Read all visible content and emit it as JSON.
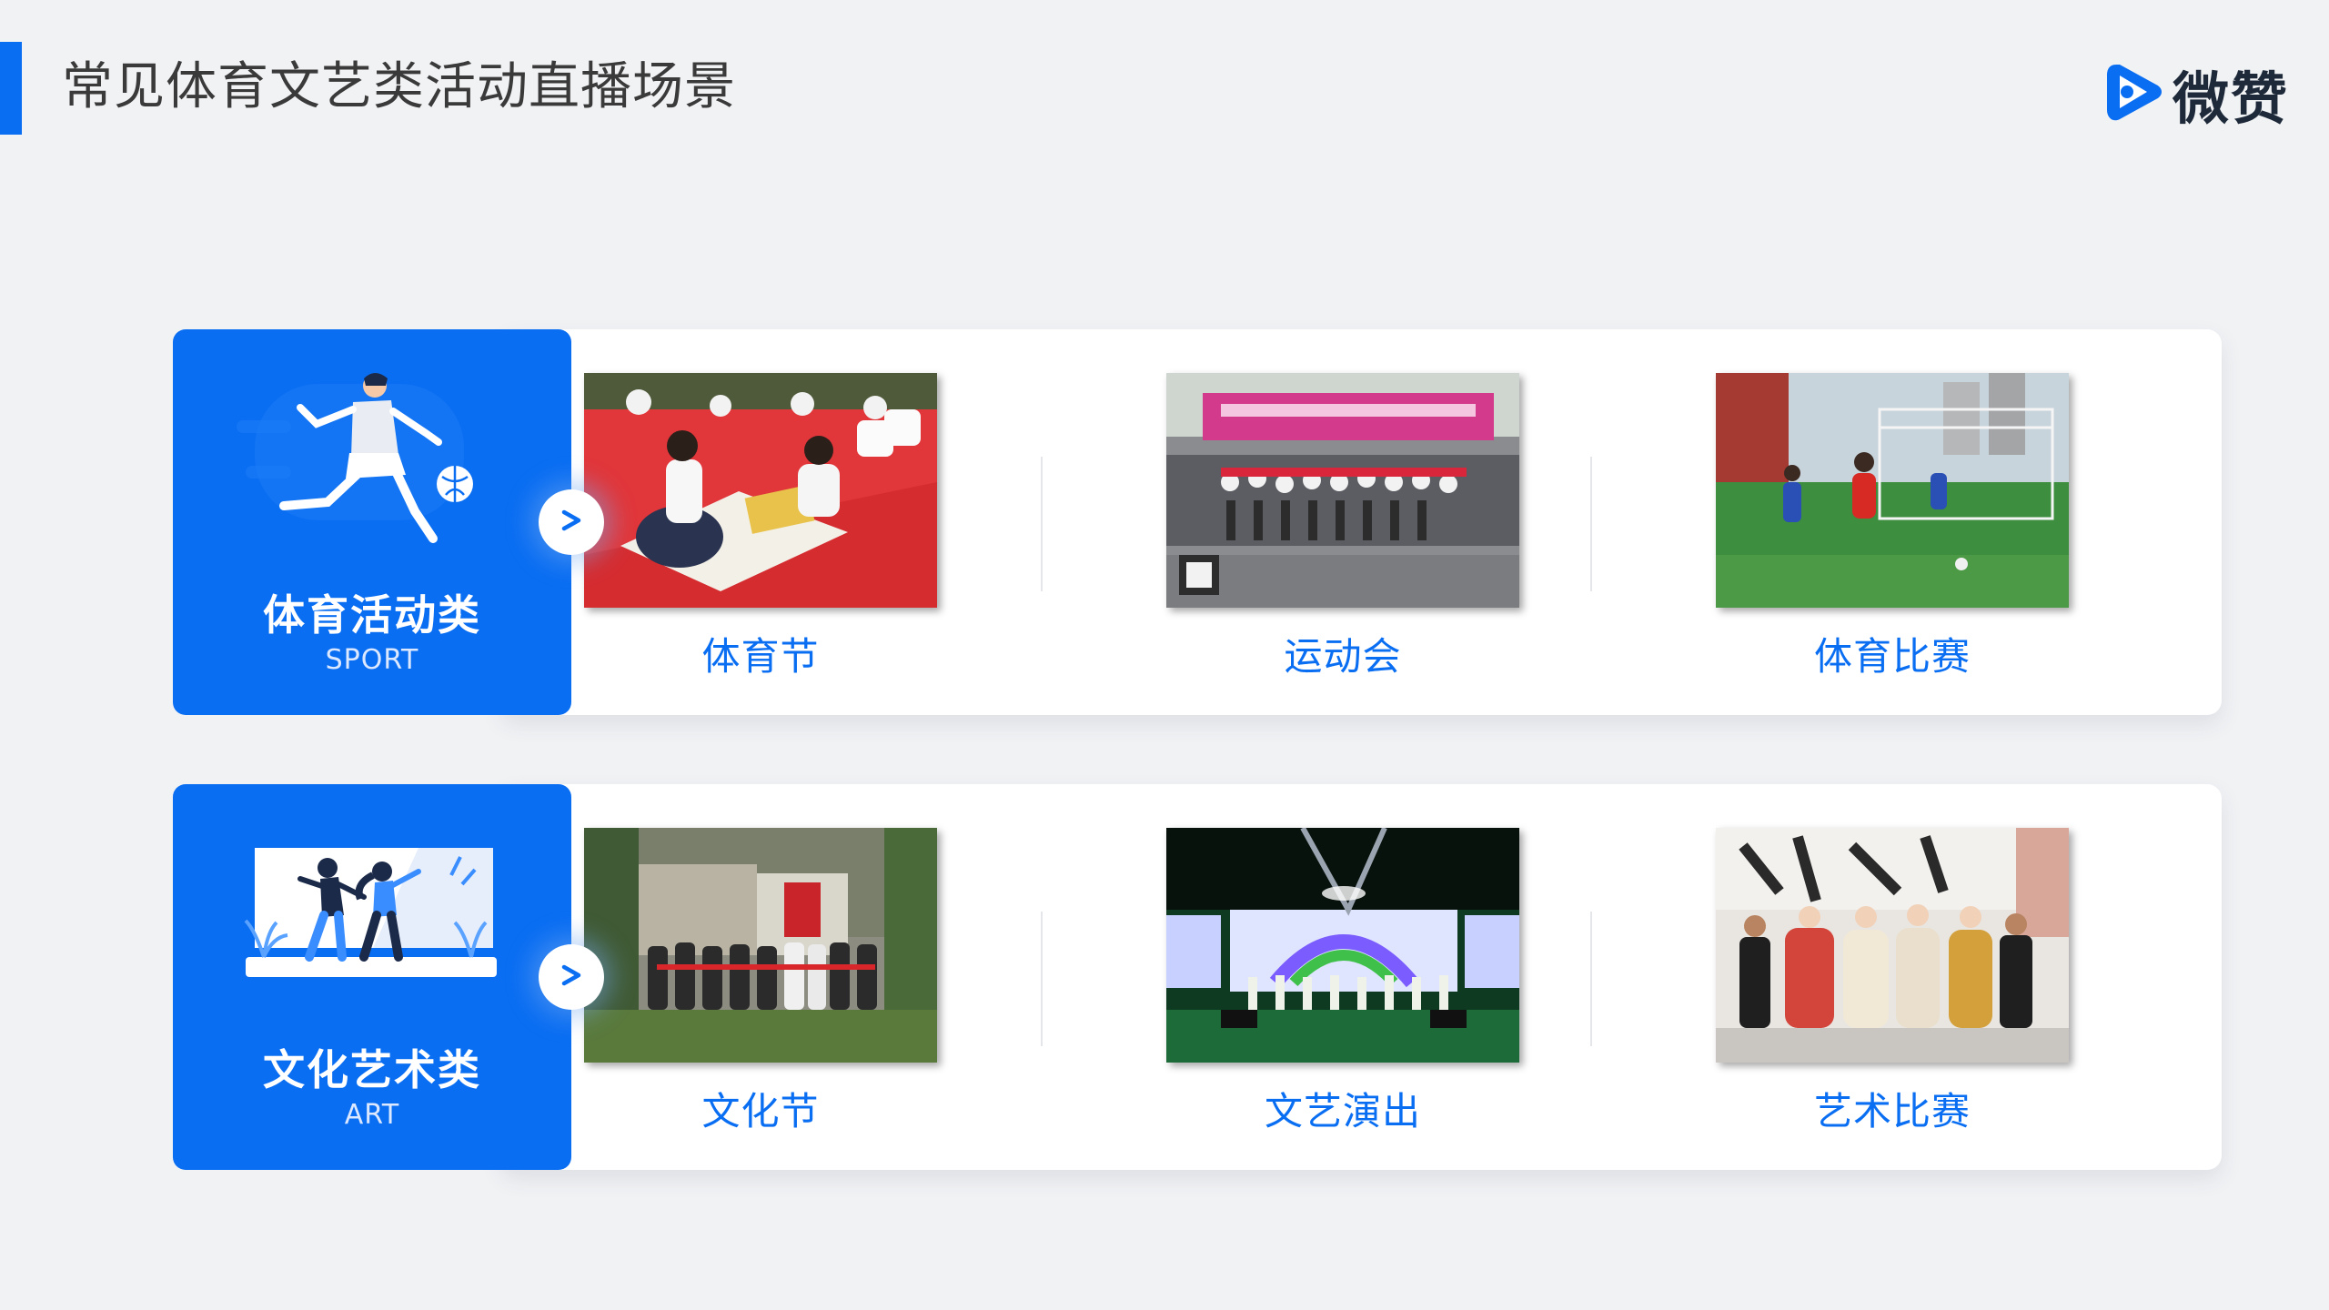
{
  "title": "常见体育文艺类活动直播场景",
  "logo": {
    "text": "微赞",
    "icon": "play-triangle-logo-icon"
  },
  "colors": {
    "accent": "#0a6ef2",
    "background": "#f1f2f4"
  },
  "categories": [
    {
      "title": "体育活动类",
      "subtitle": "SPORT",
      "illustration": "soccer-player-illustration",
      "items": [
        {
          "label": "体育节",
          "photo": "students-playing-go-photo"
        },
        {
          "label": "运动会",
          "photo": "marathon-start-photo"
        },
        {
          "label": "体育比赛",
          "photo": "youth-football-match-photo"
        }
      ]
    },
    {
      "title": "文化艺术类",
      "subtitle": "ART",
      "illustration": "dancing-couple-illustration",
      "items": [
        {
          "label": "文化节",
          "photo": "ribbon-cutting-ceremony-photo"
        },
        {
          "label": "文艺演出",
          "photo": "stage-dance-performance-photo"
        },
        {
          "label": "艺术比赛",
          "photo": "costume-contest-stage-photo"
        }
      ]
    }
  ]
}
